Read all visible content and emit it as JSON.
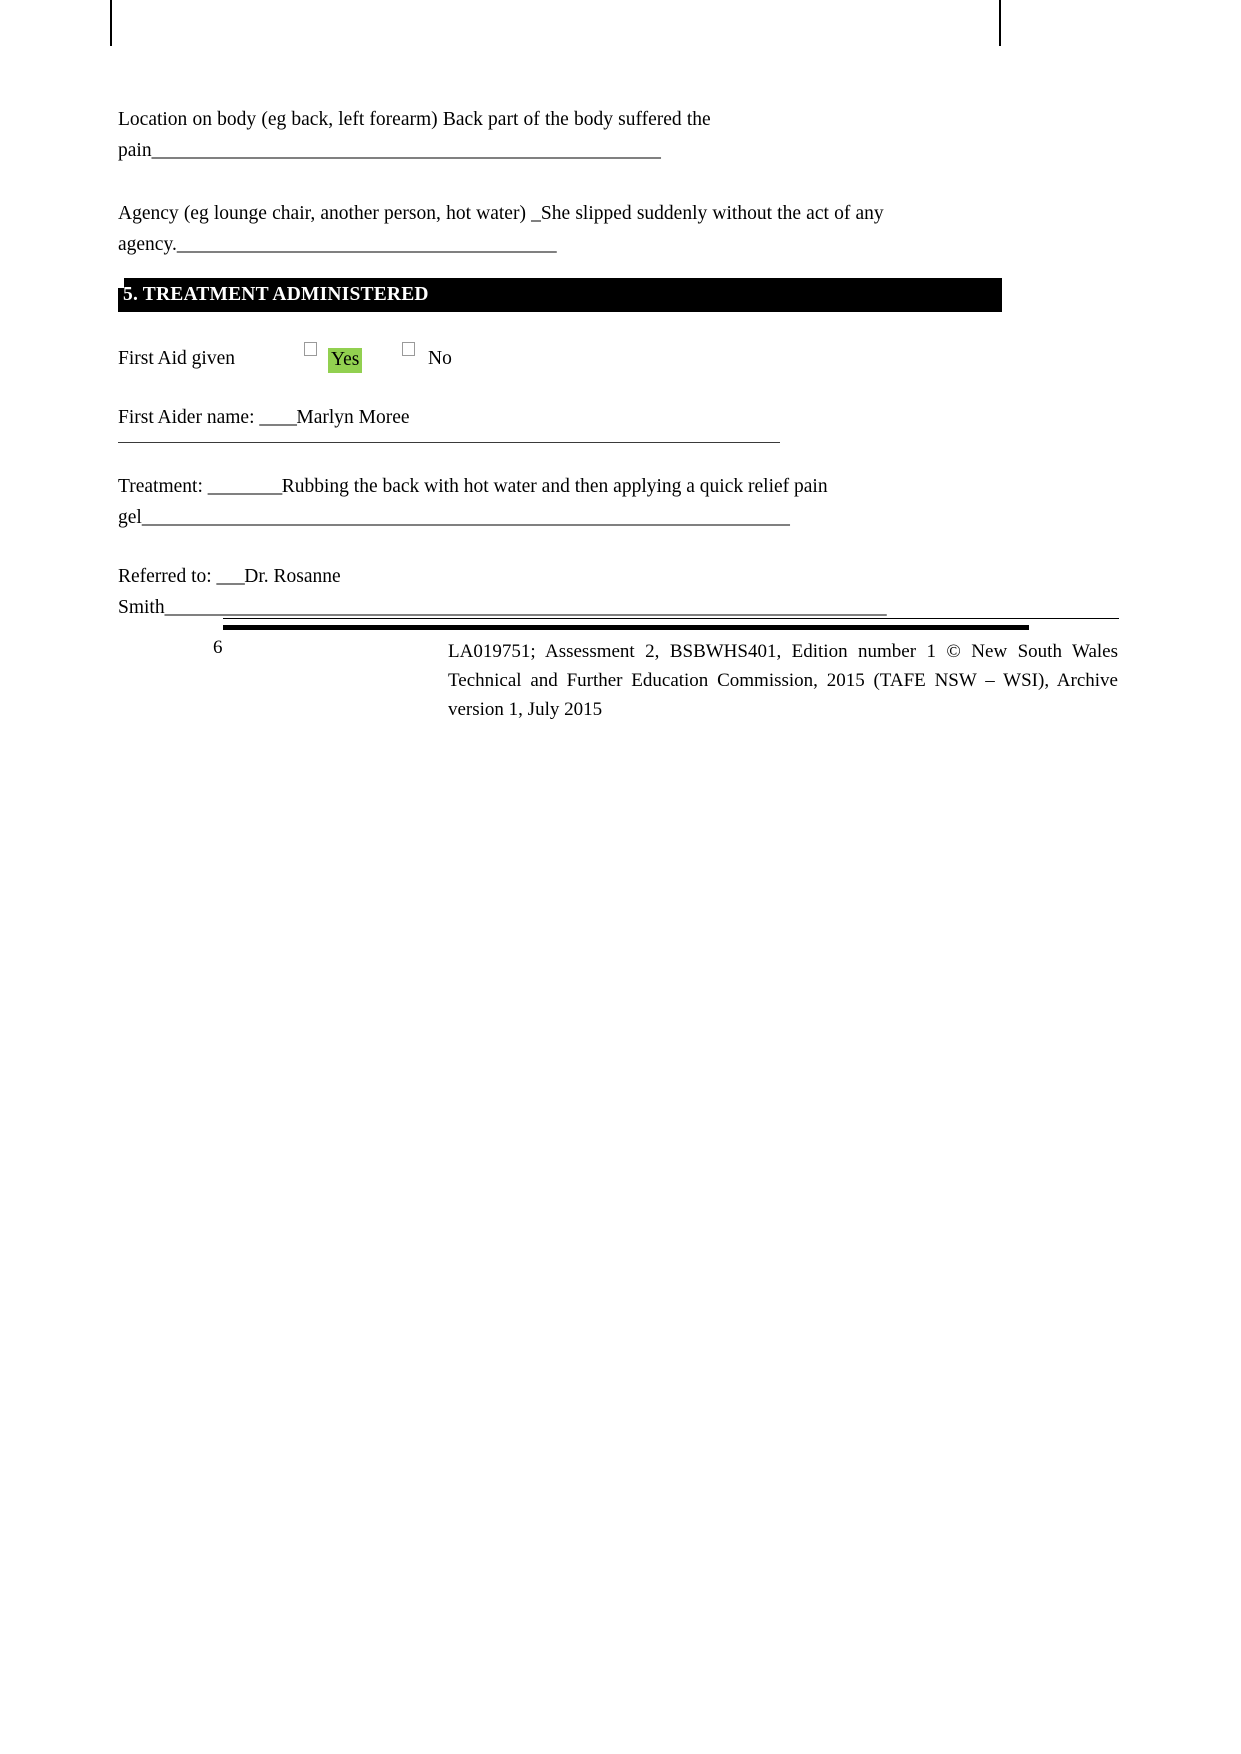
{
  "document": {
    "page_number": "6"
  },
  "body": {
    "location_field": {
      "label": "Location on body (eg back, left forearm) ",
      "value": "Back part of the body suffered the pain",
      "fill_line": "_______________________________________________________"
    },
    "agency_field": {
      "label": "Agency (eg lounge chair, another person, hot water) ",
      "value": "_She slipped suddenly without the act of any agency.",
      "fill_line": "_________________________________________"
    }
  },
  "section": {
    "heading": "5. TREATMENT ADMINISTERED"
  },
  "first_aid": {
    "label": "First Aid given",
    "option_yes": "Yes",
    "option_no": "No",
    "yes_highlight_color": "#92D050",
    "yes_checked": false,
    "no_checked": false
  },
  "fields": {
    "first_aider": {
      "label": "First Aider name: ",
      "lead_fill": "____",
      "value": "Marlyn Moree"
    },
    "treatment": {
      "label": "Treatment: ",
      "lead_fill": "________",
      "value": "Rubbing the back with hot water and then applying a quick relief pain gel",
      "fill_line": "______________________________________________________________________"
    },
    "referred_to": {
      "label": "Referred to: ",
      "lead_fill": "___",
      "value": "Dr. Rosanne Smith",
      "fill_line": "______________________________________________________________________________"
    }
  },
  "footer": {
    "page_number": "6",
    "text": "LA019751; Assessment 2, BSBWHS401, Edition number 1 © New South Wales Technical and Further Education Commission, 2015 (TAFE NSW – WSI), Archive version 1, July 2015"
  }
}
